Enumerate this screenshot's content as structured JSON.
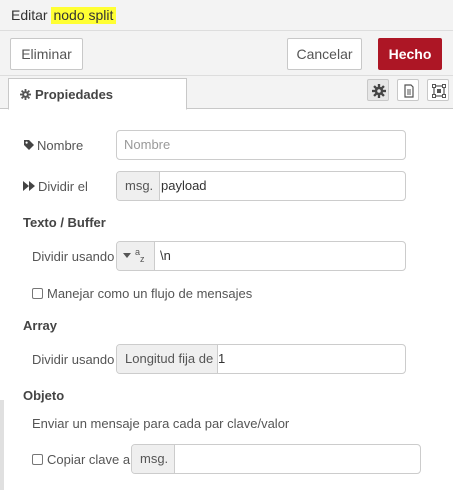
{
  "header": {
    "title_prefix": "Editar ",
    "title_node": "nodo split"
  },
  "toolbar": {
    "delete_label": "Eliminar",
    "cancel_label": "Cancelar",
    "done_label": "Hecho"
  },
  "tabs": {
    "properties_label": "Propiedades",
    "icons": [
      "gear-icon",
      "description-icon",
      "appearance-icon"
    ]
  },
  "form": {
    "name": {
      "label": "Nombre",
      "placeholder": "Nombre"
    },
    "split_on": {
      "label": "Dividir el",
      "type_tag": "msg.",
      "value": "payload"
    },
    "text_buffer": {
      "heading": "Texto / Buffer",
      "split_using_label": "Dividir usando",
      "type_glyph_a": "a",
      "type_glyph_z": "z",
      "value": "\\n",
      "stream_label": "Manejar como un flujo de mensajes",
      "stream_checked": false
    },
    "array": {
      "heading": "Array",
      "split_using_label": "Dividir usando",
      "mode": "Longitud fija de",
      "value": "1"
    },
    "object": {
      "heading": "Objeto",
      "description": "Enviar un mensaje para cada par clave/valor",
      "copy_key_label": "Copiar clave a",
      "copy_key_checked": false,
      "type_tag": "msg.",
      "value": ""
    }
  },
  "colors": {
    "accent": "#ad1625",
    "highlight": "#ffff33",
    "panel_bg": "#f3f3f3"
  }
}
